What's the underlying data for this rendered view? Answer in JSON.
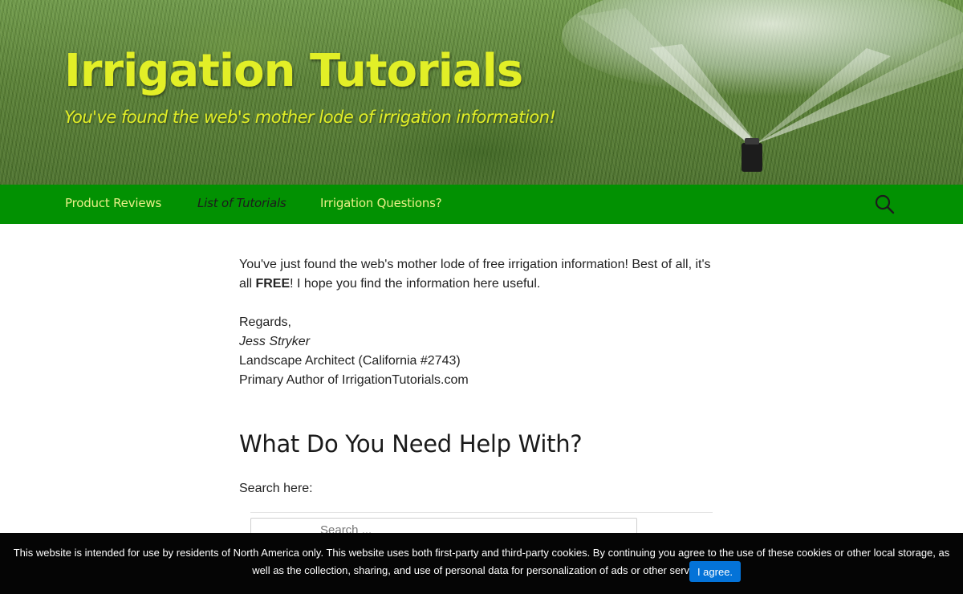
{
  "header": {
    "site_title": "Irrigation Tutorials",
    "tagline": "You've found the web's mother lode of irrigation information!"
  },
  "nav": {
    "items": [
      {
        "label": "Product Reviews",
        "active": false
      },
      {
        "label": "List of Tutorials",
        "active": true
      },
      {
        "label": "Irrigation Questions?",
        "active": false
      }
    ],
    "search_icon": "search-icon"
  },
  "intro": {
    "line1": "You've just found the web's mother lode of free irrigation information! Best of all, it's",
    "line2_prefix": "all ",
    "line2_bold": "FREE",
    "line2_suffix": "! I hope you find the information here useful."
  },
  "signature": {
    "regards": "Regards,",
    "name": "Jess Stryker",
    "title": "Landscape Architect (California #2743)",
    "role": "Primary Author of IrrigationTutorials.com"
  },
  "help_section": {
    "heading": "What Do You Need Help With?",
    "search_label": "Search here:",
    "search_placeholder": "Search ..."
  },
  "cookie_banner": {
    "text": "This website is intended for use by residents of North America only. This website uses both first-party and third-party cookies. By continuing you agree to the use of these cookies or other local storage, as well as the collection, sharing, and use of personal data for personalization of ads or other services.",
    "button_label": "I agree."
  },
  "colors": {
    "nav_bg": "#029102",
    "title_yellow": "#e2ef27",
    "nav_text": "#e9ef87",
    "button_blue": "#0473d8"
  }
}
